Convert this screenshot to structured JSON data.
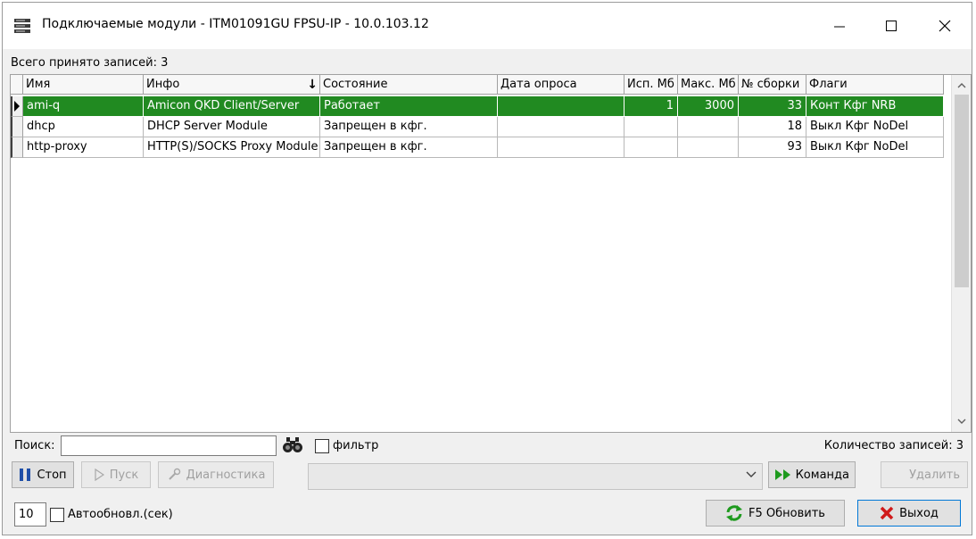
{
  "window": {
    "title": "Подключаемые модули - ITM01091GU FPSU-IP - 10.0.103.12"
  },
  "grid": {
    "records_label": "Всего принято записей: 3",
    "columns": [
      "Имя",
      "Инфо",
      "Состояние",
      "Дата опроса",
      "Исп. Мб",
      "Макс. Мб",
      "№ сборки",
      "Флаги"
    ],
    "rows": [
      {
        "name": "ami-q",
        "info": "Amicon QKD Client/Server",
        "state": "Работает",
        "poll_date": "",
        "used_mb": "1",
        "max_mb": "3000",
        "build": "33",
        "flags": "Конт Кфг NRB"
      },
      {
        "name": "dhcp",
        "info": "DHCP Server Module",
        "state": "Запрещен в кфг.",
        "poll_date": "",
        "used_mb": "",
        "max_mb": "",
        "build": "18",
        "flags": "Выкл Кфг NoDel"
      },
      {
        "name": "http-proxy",
        "info": "HTTP(S)/SOCKS Proxy Module",
        "state": "Запрещен в кфг.",
        "poll_date": "",
        "used_mb": "",
        "max_mb": "",
        "build": "93",
        "flags": "Выкл Кфг NoDel"
      }
    ],
    "selected_row": 0
  },
  "search": {
    "label": "Поиск:",
    "value": "",
    "filter_label": "фильтр",
    "count_label": "Количество записей: 3"
  },
  "buttons": {
    "stop": "Стоп",
    "start": "Пуск",
    "diagnostics": "Диагностика",
    "command": "Команда",
    "delete": "Удалить",
    "refresh": "F5 Обновить",
    "exit": "Выход"
  },
  "command_combo": {
    "value": ""
  },
  "autorefresh": {
    "interval": "10",
    "label": "Автообновл.(сек)"
  },
  "colors": {
    "selected_row": "#218a21",
    "stop_icon": "#1f4fa8",
    "command_icon": "#1e9a1e",
    "exit_icon": "#d01a1a"
  }
}
